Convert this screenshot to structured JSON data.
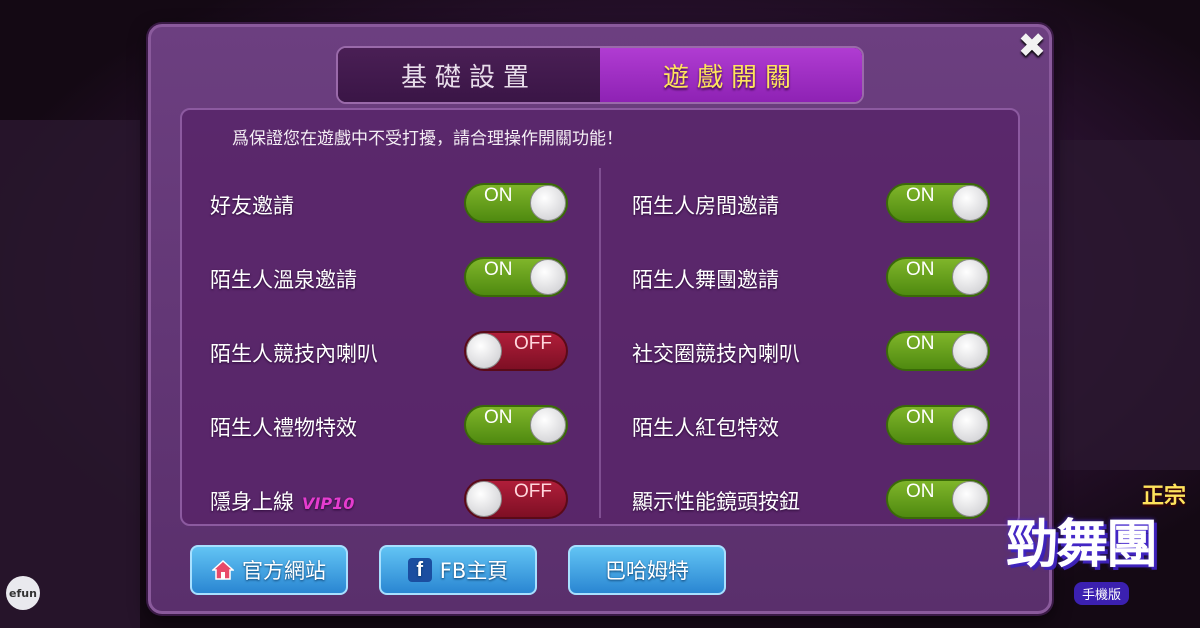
{
  "tabs": [
    {
      "label": "基礎設置",
      "active": false
    },
    {
      "label": "遊戲開關",
      "active": true
    }
  ],
  "notice": "爲保證您在遊戲中不受打擾，請合理操作開關功能！",
  "settings_left": [
    {
      "label": "好友邀請",
      "state": "ON"
    },
    {
      "label": "陌生人溫泉邀請",
      "state": "ON"
    },
    {
      "label": "陌生人競技內喇叭",
      "state": "OFF"
    },
    {
      "label": "陌生人禮物特效",
      "state": "ON"
    },
    {
      "label": "隱身上線",
      "badge": "VIP10",
      "state": "OFF"
    }
  ],
  "settings_right": [
    {
      "label": "陌生人房間邀請",
      "state": "ON"
    },
    {
      "label": "陌生人舞團邀請",
      "state": "ON"
    },
    {
      "label": "社交圈競技內喇叭",
      "state": "ON"
    },
    {
      "label": "陌生人紅包特效",
      "state": "ON"
    },
    {
      "label": "顯示性能鏡頭按鈕",
      "state": "ON"
    }
  ],
  "buttons": {
    "official_site": "官方網站",
    "fb_page": "FB主頁",
    "bahamut": "巴哈姆特"
  },
  "icons": {
    "close": "close-icon",
    "home": "home-icon",
    "facebook": "facebook-icon"
  },
  "brand": {
    "efun": "efun",
    "tag": "正宗",
    "name": "勁舞團",
    "sub": "手機版"
  },
  "colors": {
    "toggle_on": "#5f9a18",
    "toggle_off": "#9a1630",
    "active_tab_text": "#ffe45c",
    "button_blue": "#3a9ae0"
  }
}
